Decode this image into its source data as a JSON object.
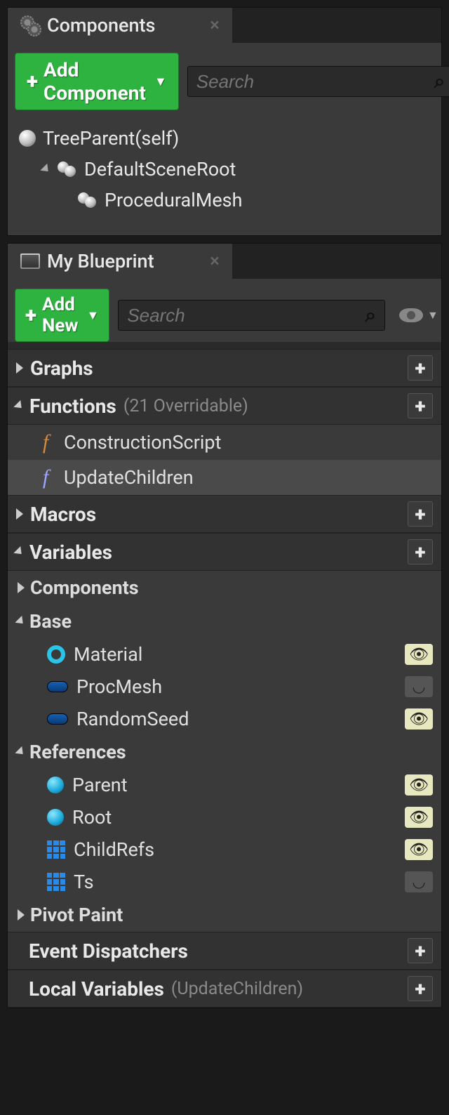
{
  "components": {
    "tabTitle": "Components",
    "addButton": "Add Component",
    "searchPlaceholder": "Search",
    "tree": {
      "root": "TreeParent(self)",
      "sceneRoot": "DefaultSceneRoot",
      "child": "ProceduralMesh"
    }
  },
  "blueprint": {
    "tabTitle": "My Blueprint",
    "addButton": "Add New",
    "searchPlaceholder": "Search",
    "sections": {
      "graphs": {
        "label": "Graphs"
      },
      "functions": {
        "label": "Functions",
        "sub": "(21 Overridable)",
        "items": [
          "ConstructionScript",
          "UpdateChildren"
        ]
      },
      "macros": {
        "label": "Macros"
      },
      "variables": {
        "label": "Variables",
        "groups": {
          "components": {
            "label": "Components"
          },
          "base": {
            "label": "Base",
            "items": [
              {
                "name": "Material",
                "icon": "ring-cyan",
                "eye": "open"
              },
              {
                "name": "ProcMesh",
                "icon": "pill-blue",
                "eye": "closed"
              },
              {
                "name": "RandomSeed",
                "icon": "pill-blue",
                "eye": "open"
              }
            ]
          },
          "references": {
            "label": "References",
            "items": [
              {
                "name": "Parent",
                "icon": "ball-cyan",
                "eye": "open"
              },
              {
                "name": "Root",
                "icon": "ball-cyan",
                "eye": "open"
              },
              {
                "name": "ChildRefs",
                "icon": "grid-blue",
                "eye": "open"
              },
              {
                "name": "Ts",
                "icon": "grid-blue",
                "eye": "closed"
              }
            ]
          },
          "pivotPaint": {
            "label": "Pivot Paint"
          }
        }
      },
      "eventDispatchers": {
        "label": "Event Dispatchers"
      },
      "localVariables": {
        "label": "Local Variables",
        "sub": "(UpdateChildren)"
      }
    }
  }
}
